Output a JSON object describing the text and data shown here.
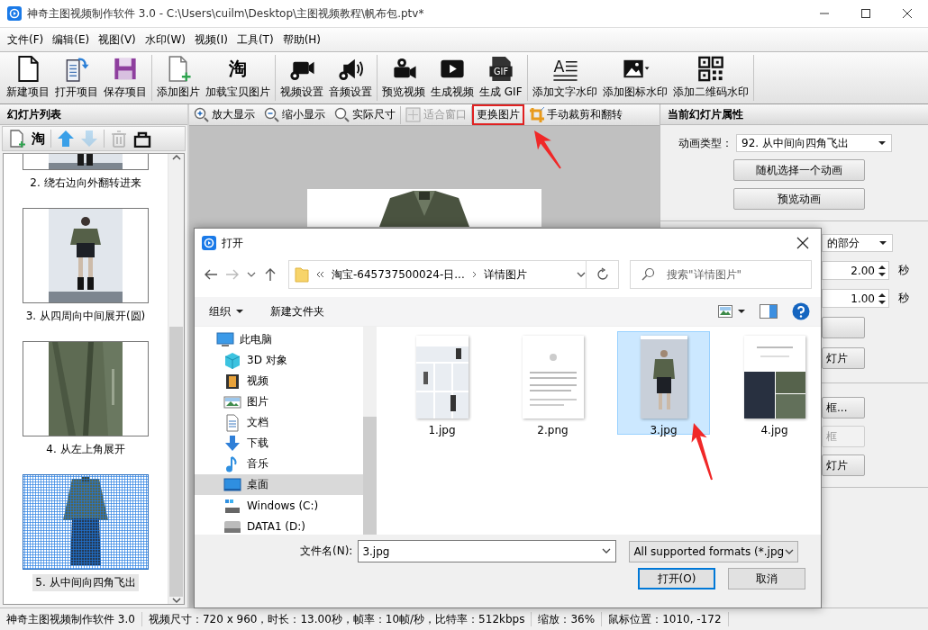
{
  "window": {
    "title": "神奇主图视频制作软件 3.0 - C:\\Users\\cuilm\\Desktop\\主图视频教程\\帆布包.ptv*"
  },
  "menu": [
    "文件(F)",
    "编辑(E)",
    "视图(V)",
    "水印(W)",
    "视频(I)",
    "工具(T)",
    "帮助(H)"
  ],
  "toolbar": [
    [
      {
        "label": "新建项目",
        "kind": "new-file"
      },
      {
        "label": "打开项目",
        "kind": "open-file"
      },
      {
        "label": "保存项目",
        "kind": "save"
      }
    ],
    [
      {
        "label": "添加图片",
        "kind": "add-image"
      },
      {
        "label": "加载宝贝图片",
        "kind": "glyph",
        "icon_text": "淘"
      }
    ],
    [
      {
        "label": "视频设置",
        "kind": "video-settings"
      },
      {
        "label": "音频设置",
        "kind": "audio-settings"
      }
    ],
    [
      {
        "label": "预览视频",
        "kind": "preview"
      },
      {
        "label": "生成视频",
        "kind": "render"
      },
      {
        "label": "生成 GIF",
        "kind": "gif",
        "icon_text": "GIF"
      }
    ],
    [
      {
        "label": "添加文字水印",
        "kind": "text-mark",
        "icon_text": "A"
      },
      {
        "label": "添加图标水印",
        "kind": "image-mark"
      },
      {
        "label": "添加二维码水印",
        "kind": "qr-mark"
      }
    ]
  ],
  "slide_panel": {
    "title": "幻灯片列表",
    "tools": [
      {
        "kind": "add",
        "disabled": false
      },
      {
        "kind": "glyph",
        "icon_text": "淘",
        "disabled": false
      },
      {
        "kind": "up",
        "disabled": false
      },
      {
        "kind": "down",
        "disabled": true
      },
      {
        "kind": "delete",
        "disabled": true
      },
      {
        "kind": "clear",
        "disabled": false
      }
    ],
    "slides": [
      {
        "caption": "2. 绕右边向外翻转进来",
        "selected": false
      },
      {
        "caption": "3. 从四周向中间展开(圆)",
        "selected": false
      },
      {
        "caption": "4. 从左上角展开",
        "selected": false
      },
      {
        "caption": "5. 从中间向四角飞出",
        "selected": true
      }
    ]
  },
  "preview": {
    "tools": [
      {
        "label": "放大显示",
        "kind": "zoom-in",
        "disabled": false,
        "highlighted": false
      },
      {
        "label": "缩小显示",
        "kind": "zoom-out",
        "disabled": false,
        "highlighted": false
      },
      {
        "label": "实际尺寸",
        "kind": "actual",
        "disabled": false,
        "highlighted": false
      },
      {
        "label": "适合窗口",
        "kind": "fit",
        "disabled": true,
        "highlighted": false
      },
      {
        "label": "更换图片",
        "kind": "none",
        "disabled": false,
        "highlighted": true
      },
      {
        "label": "手动裁剪和翻转",
        "kind": "crop",
        "disabled": false,
        "highlighted": false
      }
    ]
  },
  "properties": {
    "title": "当前幻灯片属性",
    "animation_label": "动画类型：",
    "animation_value": "92. 从中间向四角飞出",
    "buttons": [
      "随机选择一个动画",
      "预览动画"
    ],
    "select_value": "的部分",
    "spins": [
      {
        "value": "2.00",
        "unit": "秒"
      },
      {
        "value": "1.00",
        "unit": "秒"
      }
    ],
    "section2_buttons": [
      {
        "disabled": false
      },
      {
        "label": "灯片",
        "disabled": false
      }
    ],
    "section3_buttons": [
      {
        "label": "框...",
        "disabled": false
      },
      {
        "label": "框",
        "disabled": true
      },
      {
        "label": "灯片",
        "disabled": false
      }
    ]
  },
  "dialog": {
    "title": "打开",
    "path": [
      "淘宝-645737500024-日...",
      "详情图片"
    ],
    "search_placeholder": "搜索\"详情图片\"",
    "organize": "组织",
    "new_folder": "新建文件夹",
    "tree": [
      {
        "label": "此电脑",
        "kind": "pc",
        "selected": false,
        "children": [
          {
            "label": "3D 对象",
            "kind": "objects",
            "selected": false
          },
          {
            "label": "视频",
            "kind": "video",
            "selected": false
          },
          {
            "label": "图片",
            "kind": "pictures",
            "selected": false
          },
          {
            "label": "文档",
            "kind": "docs",
            "selected": false
          },
          {
            "label": "下载",
            "kind": "downloads",
            "selected": false
          },
          {
            "label": "音乐",
            "kind": "music",
            "selected": false
          },
          {
            "label": "桌面",
            "kind": "desktop",
            "selected": true
          },
          {
            "label": "Windows (C:)",
            "kind": "drive-c",
            "selected": false
          },
          {
            "label": "DATA1 (D:)",
            "kind": "drive",
            "selected": false
          }
        ]
      }
    ],
    "files": [
      {
        "name": "1.jpg",
        "selected": false
      },
      {
        "name": "2.png",
        "selected": false
      },
      {
        "name": "3.jpg",
        "selected": true
      },
      {
        "name": "4.jpg",
        "selected": false
      }
    ],
    "file_name_label": "文件名(N):",
    "file_name": "3.jpg",
    "filter": "All supported formats (*.jpg",
    "buttons": [
      {
        "label": "打开(O)",
        "default": true
      },
      {
        "label": "取消",
        "default": false
      }
    ]
  },
  "status_bar": [
    "神奇主图视频制作软件 3.0",
    "视频尺寸：720 x 960，时长：13.00秒，帧率：10帧/秒，比特率：512kbps",
    "缩放：36%",
    "鼠标位置：1010, -172"
  ]
}
